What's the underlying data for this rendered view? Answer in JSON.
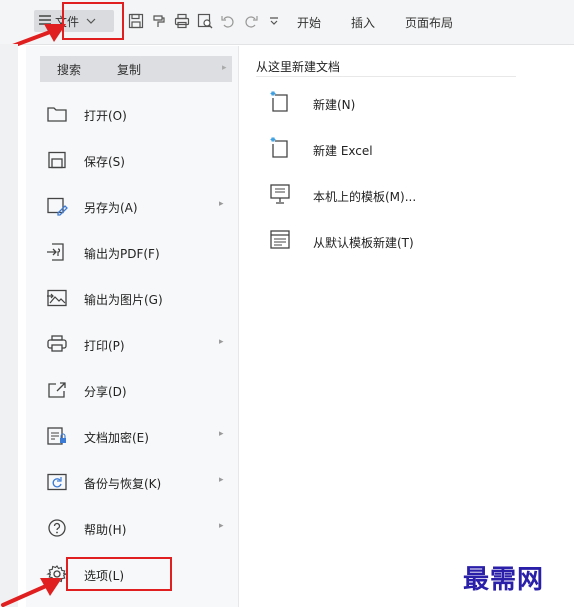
{
  "colors": {
    "accent": "#e02020",
    "watermark": "#2a1fa8"
  },
  "toolbar": {
    "file_label": "文件",
    "tabs": [
      "开始",
      "插入",
      "页面布局"
    ],
    "icons": [
      "hamburger-icon",
      "chevron-down-icon",
      "save-icon",
      "format-painter-icon",
      "print-icon",
      "print-preview-icon",
      "undo-icon",
      "redo-icon",
      "more-icon"
    ]
  },
  "menu": {
    "search_tabs": [
      "搜索",
      "复制"
    ],
    "items": [
      {
        "label": "打开(O)",
        "icon": "folder-open-icon",
        "submenu": false
      },
      {
        "label": "保存(S)",
        "icon": "save-icon",
        "submenu": false
      },
      {
        "label": "另存为(A)",
        "icon": "save-as-icon",
        "submenu": true
      },
      {
        "label": "输出为PDF(F)",
        "icon": "export-pdf-icon",
        "submenu": false
      },
      {
        "label": "输出为图片(G)",
        "icon": "export-image-icon",
        "submenu": false
      },
      {
        "label": "打印(P)",
        "icon": "print-icon",
        "submenu": true
      },
      {
        "label": "分享(D)",
        "icon": "share-icon",
        "submenu": false
      },
      {
        "label": "文档加密(E)",
        "icon": "encrypt-icon",
        "submenu": true
      },
      {
        "label": "备份与恢复(K)",
        "icon": "backup-icon",
        "submenu": true
      },
      {
        "label": "帮助(H)",
        "icon": "help-icon",
        "submenu": true
      },
      {
        "label": "选项(L)",
        "icon": "gear-icon",
        "submenu": false
      }
    ]
  },
  "new_doc": {
    "title": "从这里新建文档",
    "items": [
      {
        "label": "新建(N)",
        "icon": "new-file-icon"
      },
      {
        "label": "新建 Excel",
        "icon": "new-file-icon"
      },
      {
        "label": "本机上的模板(M)...",
        "icon": "local-template-icon"
      },
      {
        "label": "从默认模板新建(T)",
        "icon": "default-template-icon"
      }
    ]
  },
  "watermark": "最需网"
}
